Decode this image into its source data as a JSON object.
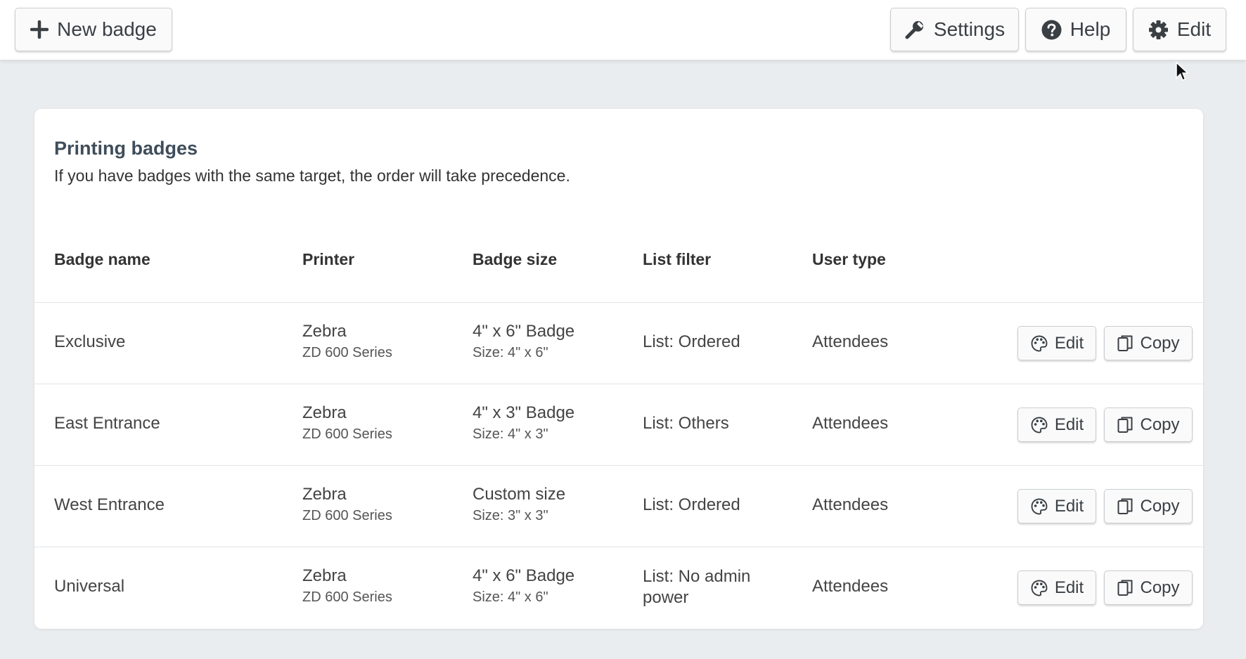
{
  "toolbar": {
    "new_badge_label": "New badge",
    "settings_label": "Settings",
    "help_label": "Help",
    "edit_label": "Edit"
  },
  "card": {
    "title": "Printing badges",
    "subtitle": "If you have badges with the same target, the order will take precedence."
  },
  "table": {
    "headers": [
      "Badge name",
      "Printer",
      "Badge size",
      "List filter",
      "User type"
    ],
    "rows": [
      {
        "name": "Exclusive",
        "printer": "Zebra",
        "printer_model": "ZD 600 Series",
        "badge": "4\" x 6\" Badge",
        "size": "Size: 4\" x 6\"",
        "filter": "List: Ordered",
        "user_type": "Attendees"
      },
      {
        "name": "East Entrance",
        "printer": "Zebra",
        "printer_model": "ZD 600 Series",
        "badge": "4\" x 3\" Badge",
        "size": "Size: 4\" x 3\"",
        "filter": "List: Others",
        "user_type": "Attendees"
      },
      {
        "name": "West Entrance",
        "printer": "Zebra",
        "printer_model": "ZD 600 Series",
        "badge": "Custom size",
        "size": "Size: 3\" x 3\"",
        "filter": "List: Ordered",
        "user_type": "Attendees"
      },
      {
        "name": "Universal",
        "printer": "Zebra",
        "printer_model": "ZD 600 Series",
        "badge": "4\" x 6\" Badge",
        "size": "Size: 4\" x 6\"",
        "filter": "List: No admin power",
        "user_type": "Attendees"
      }
    ],
    "actions": {
      "edit_label": "Edit",
      "copy_label": "Copy"
    }
  },
  "icons": {
    "new_badge": "plus-icon",
    "settings": "wrench-icon",
    "help": "question-circle-icon",
    "edit": "gear-icon",
    "row_edit": "palette-icon",
    "row_copy": "copy-icon"
  },
  "colors": {
    "page_background": "#eaedef",
    "card_background": "#ffffff",
    "title": "#3f4d5b",
    "button_background": "#fafafa"
  }
}
